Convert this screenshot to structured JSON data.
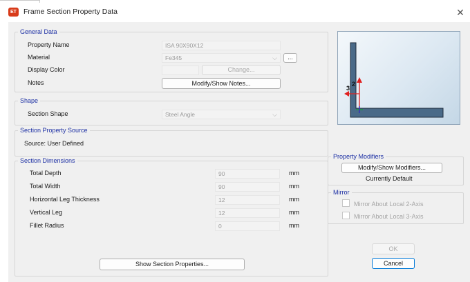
{
  "window": {
    "title": "Frame Section Property Data",
    "icon": "ET"
  },
  "general": {
    "title": "General Data",
    "property_name_label": "Property Name",
    "property_name_value": "ISA 90X90X12",
    "material_label": "Material",
    "material_value": "Fe345",
    "material_more_button": "...",
    "display_color_label": "Display Color",
    "change_button": "Change...",
    "notes_label": "Notes",
    "notes_button": "Modify/Show Notes..."
  },
  "shape": {
    "title": "Shape",
    "section_shape_label": "Section Shape",
    "section_shape_value": "Steel Angle"
  },
  "source": {
    "title": "Section Property Source",
    "source_text": "Source:  User Defined"
  },
  "dimensions": {
    "title": "Section Dimensions",
    "rows": [
      {
        "label": "Total Depth",
        "value": "90",
        "unit": "mm"
      },
      {
        "label": "Total Width",
        "value": "90",
        "unit": "mm"
      },
      {
        "label": "Horizontal Leg Thickness",
        "value": "12",
        "unit": "mm"
      },
      {
        "label": "Vertical Leg",
        "value": "12",
        "unit": "mm"
      },
      {
        "label": "Fillet Radius",
        "value": "0",
        "unit": "mm"
      }
    ],
    "show_props_button": "Show Section Properties..."
  },
  "preview": {
    "axis_2_label": "2",
    "axis_3_label": "3"
  },
  "modifiers": {
    "title": "Property Modifiers",
    "button": "Modify/Show Modifiers...",
    "status": "Currently Default"
  },
  "mirror": {
    "title": "Mirror",
    "local2_label": "Mirror About Local 2-Axis",
    "local3_label": "Mirror About Local 3-Axis"
  },
  "buttons": {
    "ok": "OK",
    "cancel": "Cancel"
  },
  "colors": {
    "accent": "#0078d7",
    "group_title": "#1b2ea3",
    "axis": "#e02020",
    "section_fill": "#4a6a88"
  }
}
